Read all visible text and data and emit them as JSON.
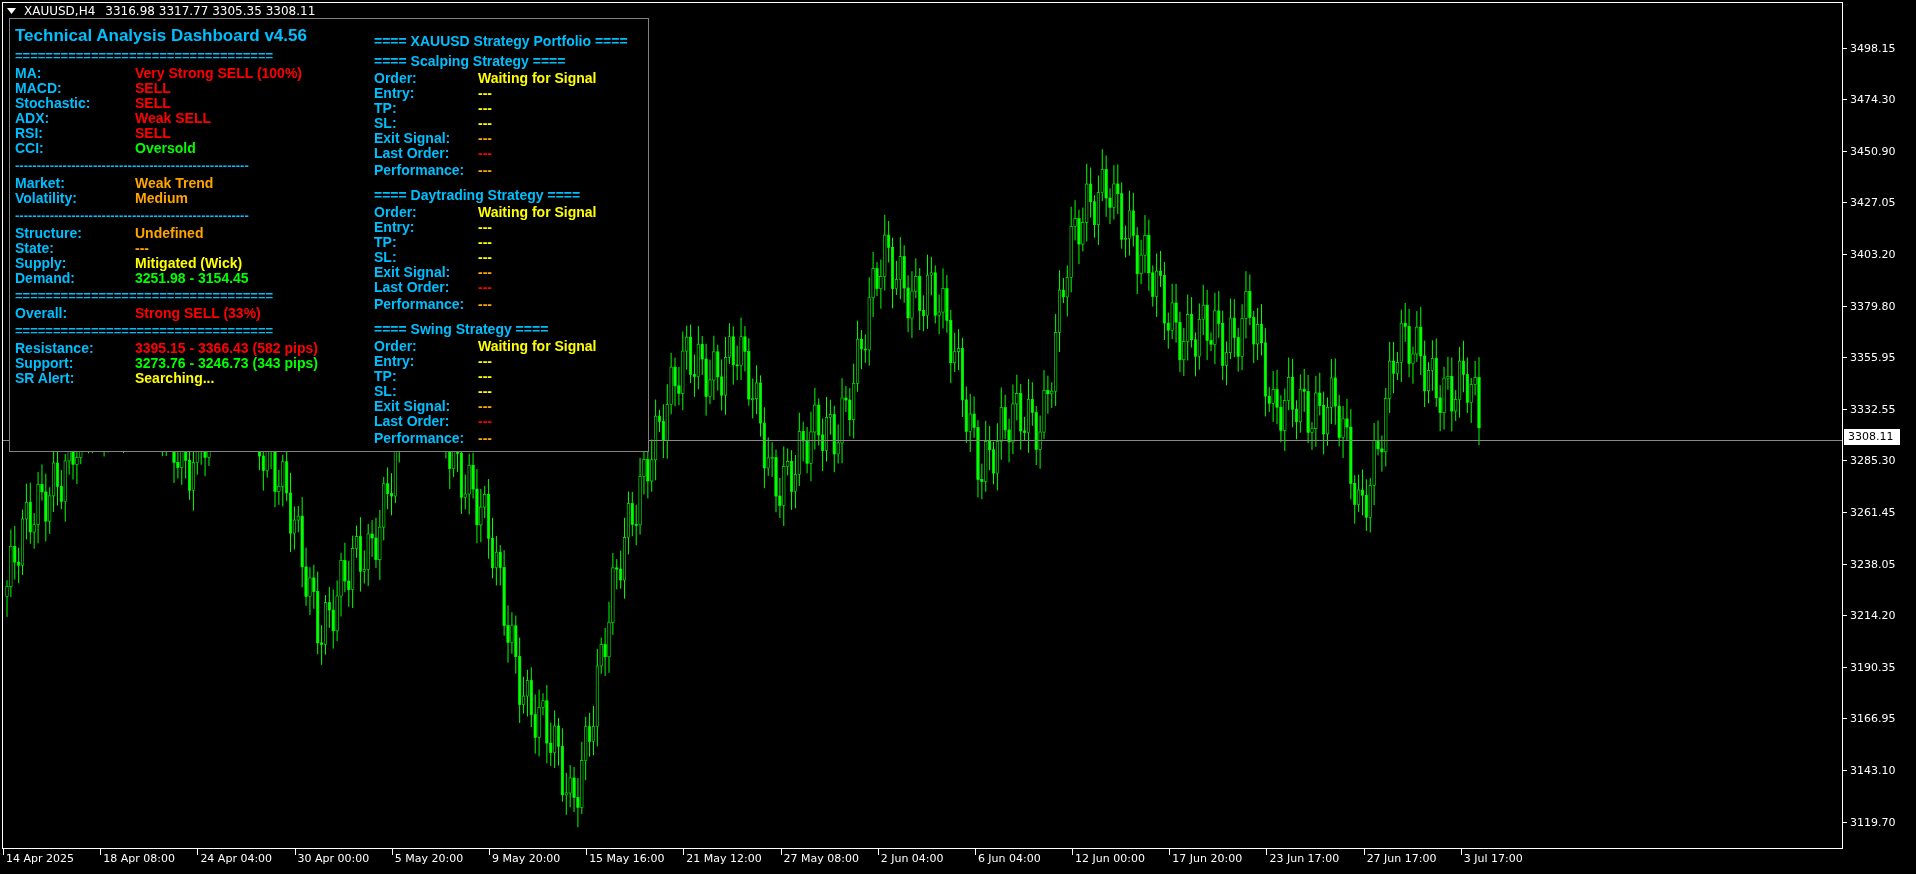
{
  "chart_header": {
    "symbol": "XAUUSD,H4",
    "ohlc": "3316.98 3317.77 3305.35 3308.11"
  },
  "dashboard": {
    "title": "Technical Analysis Dashboard v4.56",
    "lines": [
      {
        "kind": "separator",
        "text": "=================================="
      },
      {
        "kind": "row",
        "label": "MA:",
        "value": "Very Strong SELL (100%)",
        "color": "#ff0000"
      },
      {
        "kind": "row",
        "label": "MACD:",
        "value": "SELL",
        "color": "#ff0000"
      },
      {
        "kind": "row",
        "label": "Stochastic:",
        "value": "SELL",
        "color": "#ff0000"
      },
      {
        "kind": "row",
        "label": "ADX:",
        "value": "Weak SELL",
        "color": "#ff0000"
      },
      {
        "kind": "row",
        "label": "RSI:",
        "value": "SELL",
        "color": "#ff0000"
      },
      {
        "kind": "row",
        "label": "CCI:",
        "value": "Oversold",
        "color": "#00ff00"
      },
      {
        "kind": "separator",
        "text": "------------------------------------------------------"
      },
      {
        "kind": "row",
        "label": "Market:",
        "value": "Weak Trend",
        "color": "#ffa500"
      },
      {
        "kind": "row",
        "label": "Volatility:",
        "value": "Medium",
        "color": "#ffa500"
      },
      {
        "kind": "separator",
        "text": "------------------------------------------------------"
      },
      {
        "kind": "row",
        "label": "Structure:",
        "value": "Undefined",
        "color": "#ffa500"
      },
      {
        "kind": "row",
        "label": "State:",
        "value": "---",
        "color": "#ffa500"
      },
      {
        "kind": "row",
        "label": "Supply:",
        "value": "Mitigated (Wick)",
        "color": "#ffff00"
      },
      {
        "kind": "row",
        "label": "Demand:",
        "value": "3251.98 - 3154.45",
        "color": "#00ff00"
      },
      {
        "kind": "separator",
        "text": "=================================="
      },
      {
        "kind": "row",
        "label": "Overall:",
        "value": "Strong SELL (33%)",
        "color": "#ff0000"
      },
      {
        "kind": "separator",
        "text": "=================================="
      },
      {
        "kind": "row",
        "label": "Resistance:",
        "value": "3395.15 - 3366.43 (582 pips)",
        "color": "#ff0000"
      },
      {
        "kind": "row",
        "label": "Support:",
        "value": "3273.76 - 3246.73 (343 pips)",
        "color": "#00ff00"
      },
      {
        "kind": "row",
        "label": "SR Alert:",
        "value": "Searching...",
        "color": "#ffff00"
      }
    ]
  },
  "portfolio": {
    "title": "==== XAUUSD Strategy Portfolio ====",
    "strategies": [
      {
        "title": "==== Scalping Strategy ====",
        "rows": [
          {
            "label": "Order:",
            "value": "Waiting for Signal",
            "color": "#ffff00"
          },
          {
            "label": "Entry:",
            "value": "---",
            "color": "#ffff00"
          },
          {
            "label": "TP:",
            "value": "---",
            "color": "#ffff00"
          },
          {
            "label": "SL:",
            "value": "---",
            "color": "#ffff00"
          },
          {
            "label": "Exit Signal:",
            "value": "---",
            "color": "#ffa500"
          },
          {
            "label": "Last Order:",
            "value": "---",
            "color": "#ff0000"
          },
          {
            "label": "Performance:",
            "value": "---",
            "color": "#ffa500"
          }
        ]
      },
      {
        "title": "==== Daytrading Strategy ====",
        "rows": [
          {
            "label": "Order:",
            "value": "Waiting for Signal",
            "color": "#ffff00"
          },
          {
            "label": "Entry:",
            "value": "---",
            "color": "#ffff00"
          },
          {
            "label": "TP:",
            "value": "---",
            "color": "#ffff00"
          },
          {
            "label": "SL:",
            "value": "---",
            "color": "#ffff00"
          },
          {
            "label": "Exit Signal:",
            "value": "---",
            "color": "#ffa500"
          },
          {
            "label": "Last Order:",
            "value": "---",
            "color": "#ff0000"
          },
          {
            "label": "Performance:",
            "value": "---",
            "color": "#ffa500"
          }
        ]
      },
      {
        "title": "==== Swing Strategy ====",
        "rows": [
          {
            "label": "Order:",
            "value": "Waiting for Signal",
            "color": "#ffff00"
          },
          {
            "label": "Entry:",
            "value": "---",
            "color": "#ffff00"
          },
          {
            "label": "TP:",
            "value": "---",
            "color": "#ffff00"
          },
          {
            "label": "SL:",
            "value": "---",
            "color": "#ffff00"
          },
          {
            "label": "Exit Signal:",
            "value": "---",
            "color": "#ffa500"
          },
          {
            "label": "Last Order:",
            "value": "---",
            "color": "#ff0000"
          },
          {
            "label": "Performance:",
            "value": "---",
            "color": "#ffa500"
          }
        ]
      }
    ]
  },
  "price_axis": {
    "ticks": [
      "3498.15",
      "3474.30",
      "3450.90",
      "3427.05",
      "3403.20",
      "3379.80",
      "3355.95",
      "3332.55",
      "3285.30",
      "3261.45",
      "3238.05",
      "3214.20",
      "3190.35",
      "3166.95",
      "3143.10",
      "3119.70"
    ],
    "current_price": "3308.11"
  },
  "time_axis": {
    "ticks": [
      "14 Apr 2025",
      "18 Apr 08:00",
      "24 Apr 04:00",
      "30 Apr 00:00",
      "5 May 20:00",
      "9 May 20:00",
      "15 May 16:00",
      "21 May 12:00",
      "27 May 08:00",
      "2 Jun 04:00",
      "6 Jun 04:00",
      "12 Jun 00:00",
      "17 Jun 20:00",
      "23 Jun 17:00",
      "27 Jun 17:00",
      "3 Jul 17:00"
    ]
  }
}
